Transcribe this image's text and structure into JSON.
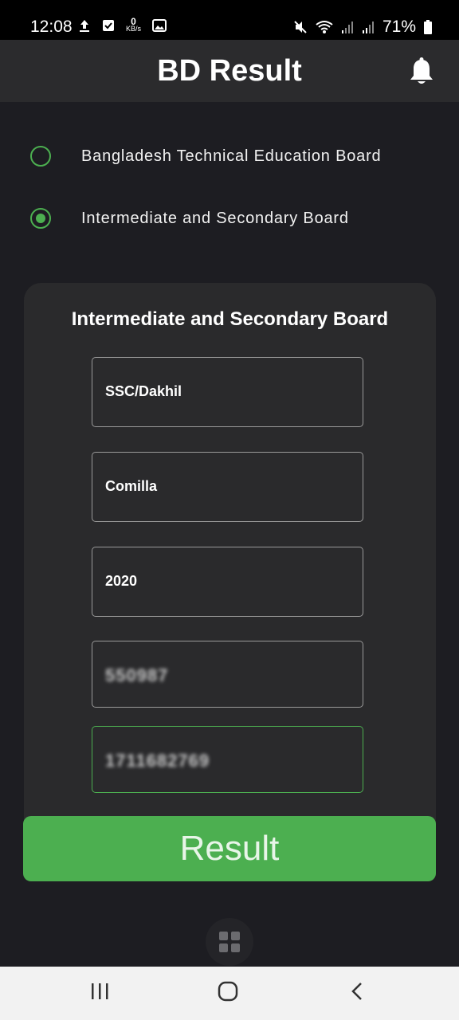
{
  "status_bar": {
    "time": "12:08",
    "kbs_value": "0",
    "kbs_unit": "KB/s",
    "battery": "71%",
    "icons_left": [
      "upload-icon",
      "checkbox-icon",
      "kbs-indicator",
      "image-icon"
    ],
    "icons_right": [
      "mute-icon",
      "wifi-icon",
      "signal-icon",
      "signal-icon",
      "battery-icon"
    ]
  },
  "app_bar": {
    "title": "BD Result",
    "action_icon": "bell-icon"
  },
  "board_options": [
    {
      "label": "Bangladesh Technical Education Board",
      "selected": false
    },
    {
      "label": "Intermediate and Secondary Board",
      "selected": true
    }
  ],
  "form": {
    "title": "Intermediate and Secondary Board",
    "exam": "SSC/Dakhil",
    "board": "Comilla",
    "year": "2020",
    "roll": "550987",
    "registration": "1711682769"
  },
  "result_button": "Result",
  "colors": {
    "accent": "#4caf50",
    "background": "#1d1d22",
    "card": "#2a2a2c",
    "appbar": "#2b2b2d"
  }
}
